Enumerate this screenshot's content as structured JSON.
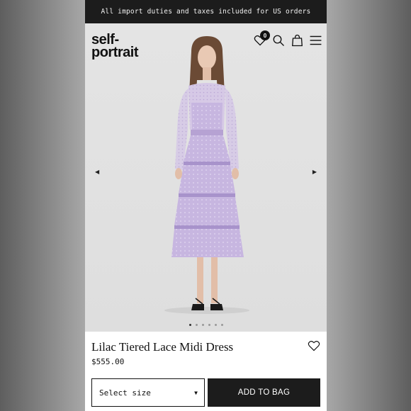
{
  "promo": {
    "text": "All import duties and taxes included for US orders"
  },
  "header": {
    "logo_line1": "self-",
    "logo_line2": "portrait",
    "wishlist_count": "0",
    "icons": [
      "heart-icon",
      "search-icon",
      "bag-icon",
      "menu-icon"
    ]
  },
  "carousel": {
    "prev_glyph": "◀",
    "next_glyph": "▶",
    "slide_count": 6,
    "active_slide": 1
  },
  "product": {
    "name": "Lilac Tiered Lace Midi Dress",
    "price": "$555.00"
  },
  "actions": {
    "size_placeholder": "Select size",
    "size_caret": "▼",
    "add_to_bag": "ADD TO BAG"
  },
  "colors": {
    "promo_bg": "#1c1c1c",
    "button_bg": "#1c1c1c",
    "dress": "#c8b6e2"
  }
}
